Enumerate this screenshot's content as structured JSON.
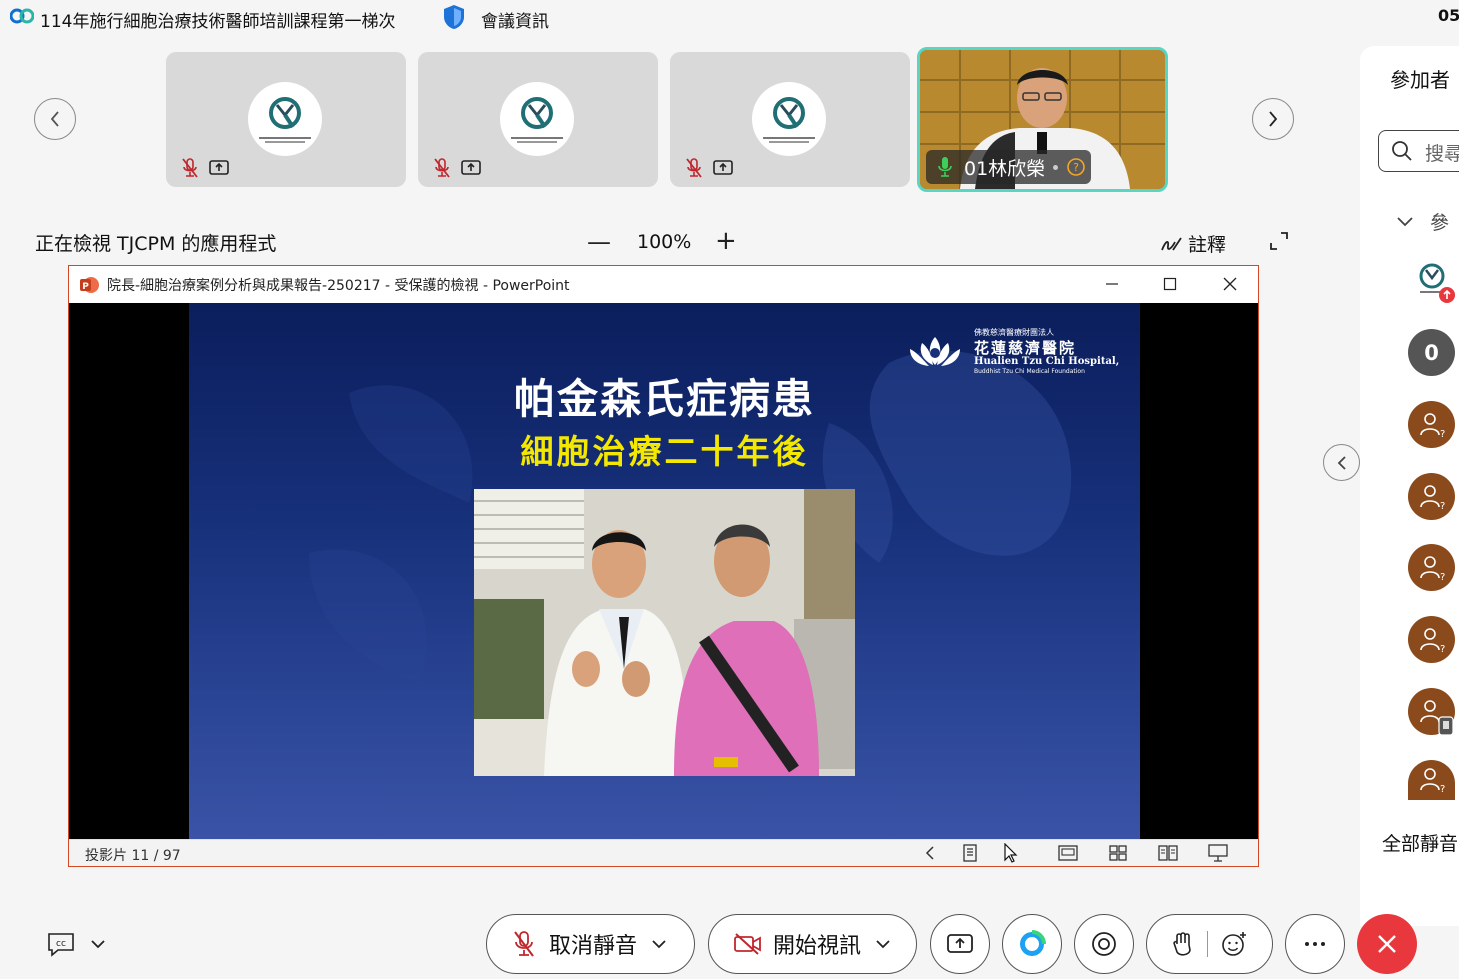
{
  "header": {
    "meeting_title": "114年施行細胞治療技術醫師培訓課程第一梯次",
    "info_label": "會議資訊",
    "clock": "05"
  },
  "filmstrip": {
    "active_speaker_name": "01林欣榮"
  },
  "viewing": {
    "label": "正在檢視 TJCPM 的應用程式",
    "zoom": "100%",
    "annotate_label": "註釋"
  },
  "ppt": {
    "window_title": "院長-細胞治療案例分析與成果報告-250217  -  受保護的檢視 - PowerPoint",
    "slide_title": "帕金森氏症病患",
    "slide_subtitle": "細胞治療二十年後",
    "hospital_name_cn": "花蓮慈濟醫院",
    "hospital_name_en": "Hualien Tzu Chi Hospital,",
    "hospital_foundation": "Buddhist Tzu Chi Medical Foundation",
    "hospital_prefix": "佛教慈濟醫療財團法人",
    "slide_counter": "投影片 11 / 97"
  },
  "panel": {
    "title": "參加者",
    "search_placeholder": "搜尋",
    "group_label": "參",
    "count_badge": "0",
    "mute_all": "全部靜音"
  },
  "toolbar": {
    "unmute_label": "取消靜音",
    "start_video_label": "開始視訊"
  },
  "colors": {
    "accent_teal": "#58d6c3",
    "leave_red": "#e8383d",
    "avatar_brown": "#8a4a1c",
    "slide_yellow": "#f5e800"
  }
}
